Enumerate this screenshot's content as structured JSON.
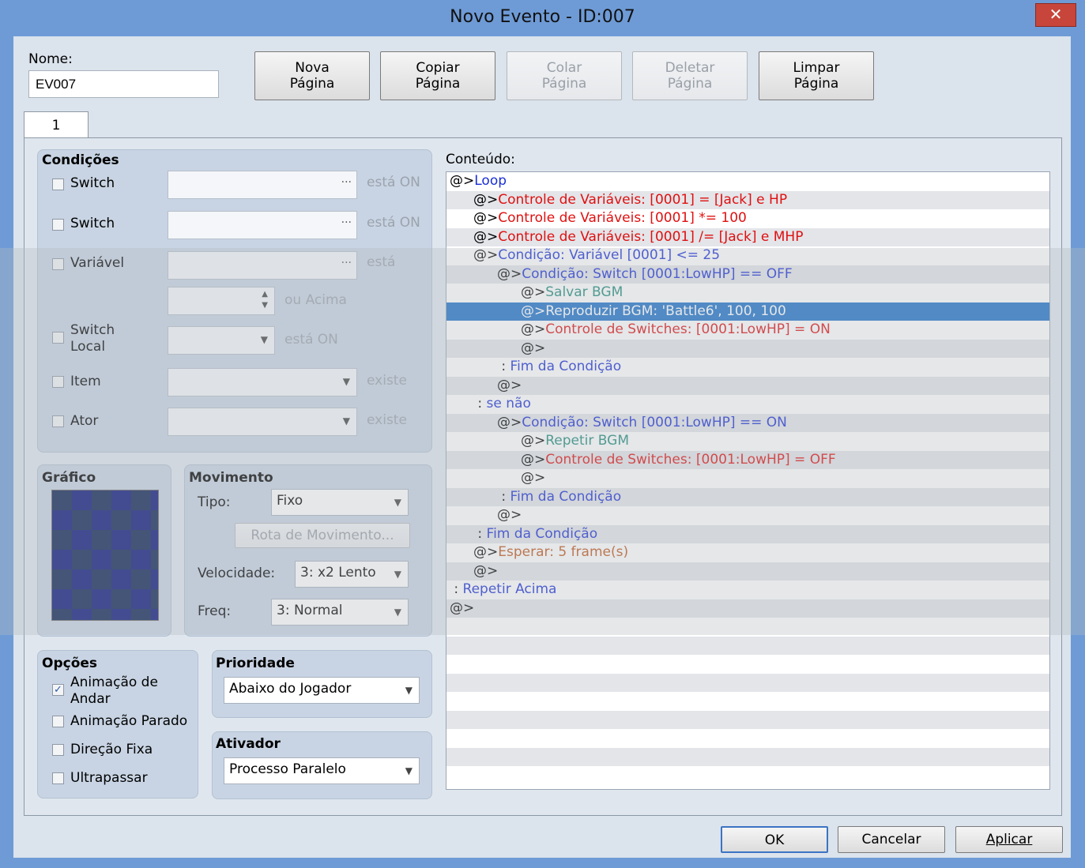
{
  "window": {
    "title": "Novo Evento - ID:007",
    "close_glyph": "✕"
  },
  "name": {
    "label": "Nome:",
    "value": "EV007"
  },
  "page_buttons": [
    {
      "line1": "Nova",
      "line2": "Página",
      "enabled": true
    },
    {
      "line1": "Copiar",
      "line2": "Página",
      "enabled": true
    },
    {
      "line1": "Colar",
      "line2": "Página",
      "enabled": false
    },
    {
      "line1": "Deletar",
      "line2": "Página",
      "enabled": false
    },
    {
      "line1": "Limpar",
      "line2": "Página",
      "enabled": true
    }
  ],
  "tab": {
    "label": "1"
  },
  "conditions": {
    "title": "Condições",
    "switch1": {
      "label": "Switch",
      "suffix": "está ON"
    },
    "switch2": {
      "label": "Switch",
      "suffix": "está ON"
    },
    "variable": {
      "label": "Variável",
      "suffix": "está",
      "ou_acima": "ou Acima"
    },
    "self_switch": {
      "label1": "Switch",
      "label2": "Local",
      "suffix": "está ON"
    },
    "item": {
      "label": "Item",
      "suffix": "existe"
    },
    "actor": {
      "label": "Ator",
      "suffix": "existe"
    },
    "ellipsis": "..."
  },
  "graphic": {
    "title": "Gráfico"
  },
  "movement": {
    "title": "Movimento",
    "type_label": "Tipo:",
    "type_value": "Fixo",
    "route_button": "Rota de Movimento...",
    "speed_label": "Velocidade:",
    "speed_value": "3: x2 Lento",
    "freq_label": "Freq:",
    "freq_value": "3: Normal"
  },
  "options": {
    "title": "Opções",
    "walk_anim": {
      "line1": "Animação de",
      "line2": "Andar",
      "checked": true
    },
    "step_anim": {
      "label": "Animação Parado",
      "checked": false
    },
    "dir_fix": {
      "label": "Direção Fixa",
      "checked": false
    },
    "through": {
      "label": "Ultrapassar",
      "checked": false
    }
  },
  "priority": {
    "title": "Prioridade",
    "value": "Abaixo do Jogador"
  },
  "trigger": {
    "title": "Ativador",
    "value": "Processo Paralelo"
  },
  "contents": {
    "label": "Conteúdo:",
    "selected_index": 7,
    "lines": [
      {
        "indent": 0,
        "prefix": "@>",
        "text": "Loop",
        "color": "#1a2fd6"
      },
      {
        "indent": 1,
        "prefix": "@>",
        "text": "Controle de Variáveis: [0001] = [Jack] e HP",
        "color": "#e01010"
      },
      {
        "indent": 1,
        "prefix": "@>",
        "text": "Controle de Variáveis: [0001] *= 100",
        "color": "#e01010"
      },
      {
        "indent": 1,
        "prefix": "@>",
        "text": "Controle de Variáveis: [0001] /= [Jack] e MHP",
        "color": "#e01010"
      },
      {
        "indent": 1,
        "prefix": "@>",
        "text": "Condição: Variável [0001] <= 25",
        "color": "#1a2fd6"
      },
      {
        "indent": 2,
        "prefix": "@>",
        "text": "Condição: Switch [0001:LowHP] == OFF",
        "color": "#1a2fd6"
      },
      {
        "indent": 3,
        "prefix": "@>",
        "text": "Salvar BGM",
        "color": "#1f8a7a"
      },
      {
        "indent": 3,
        "prefix": "@>",
        "text": "Reproduzir BGM: 'Battle6', 100, 100",
        "color": "#1f8a7a"
      },
      {
        "indent": 3,
        "prefix": "@>",
        "text": "Controle de Switches: [0001:LowHP] = ON",
        "color": "#e01010"
      },
      {
        "indent": 3,
        "prefix": "@>",
        "text": "",
        "color": "#000000"
      },
      {
        "indent": 2,
        "prefix": " : ",
        "text": "Fim da Condição",
        "color": "#1a2fd6"
      },
      {
        "indent": 2,
        "prefix": "@>",
        "text": "",
        "color": "#000000"
      },
      {
        "indent": 1,
        "prefix": " : ",
        "text": "se não",
        "color": "#1a2fd6"
      },
      {
        "indent": 2,
        "prefix": "@>",
        "text": "Condição: Switch [0001:LowHP] == ON",
        "color": "#1a2fd6"
      },
      {
        "indent": 3,
        "prefix": "@>",
        "text": "Repetir BGM",
        "color": "#1f8a7a"
      },
      {
        "indent": 3,
        "prefix": "@>",
        "text": "Controle de Switches: [0001:LowHP] = OFF",
        "color": "#e01010"
      },
      {
        "indent": 3,
        "prefix": "@>",
        "text": "",
        "color": "#000000"
      },
      {
        "indent": 2,
        "prefix": " : ",
        "text": "Fim da Condição",
        "color": "#1a2fd6"
      },
      {
        "indent": 2,
        "prefix": "@>",
        "text": "",
        "color": "#000000"
      },
      {
        "indent": 1,
        "prefix": " : ",
        "text": "Fim da Condição",
        "color": "#1a2fd6"
      },
      {
        "indent": 1,
        "prefix": "@>",
        "text": "Esperar: 5 frame(s)",
        "color": "#c0561a"
      },
      {
        "indent": 1,
        "prefix": "@>",
        "text": "",
        "color": "#000000"
      },
      {
        "indent": 0,
        "prefix": " : ",
        "text": "Repetir Acima",
        "color": "#1a2fd6"
      },
      {
        "indent": 0,
        "prefix": "@>",
        "text": "",
        "color": "#000000"
      }
    ],
    "empty_rows": 9
  },
  "footer": {
    "ok": "OK",
    "cancel": "Cancelar",
    "apply": "Aplicar"
  }
}
